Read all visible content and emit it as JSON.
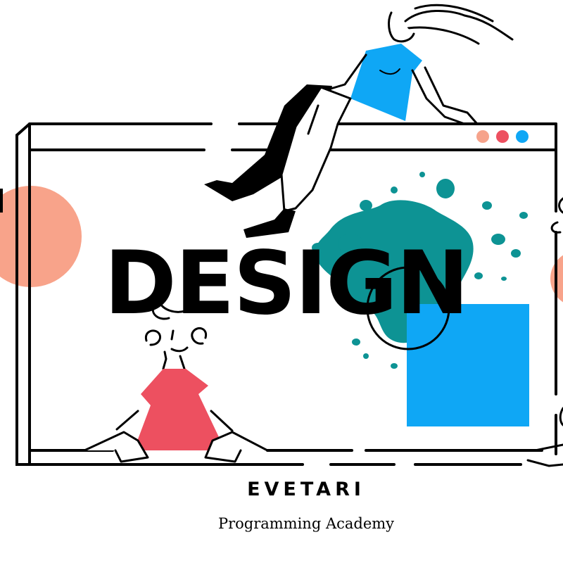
{
  "headline": "DESIGN",
  "brand": "EVETARI",
  "tagline": "Programming Academy",
  "window_controls": [
    {
      "name": "dot-1",
      "color": "#f6a38b"
    },
    {
      "name": "dot-2",
      "color": "#ed5060"
    },
    {
      "name": "dot-3",
      "color": "#0fa7f5"
    }
  ],
  "colors": {
    "salmon": "#f8a38a",
    "blue": "#0fa7f5",
    "red": "#ed5060",
    "teal": "#0d9394",
    "ink": "#000000"
  }
}
